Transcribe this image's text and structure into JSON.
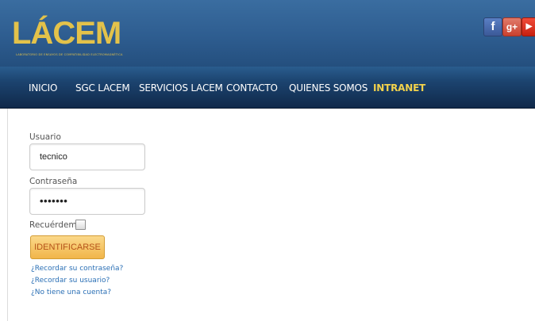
{
  "brand": {
    "logo_text": "LÁCEM",
    "logo_subtext": "LABORATORIO DE ENSAYOS DE COMPATIBILIDAD ELECTROMAGNÉTICA"
  },
  "social": {
    "facebook_glyph": "f",
    "googleplus_glyph": "g+",
    "youtube_glyph": "▶"
  },
  "nav": {
    "items": [
      {
        "label": "INICIO"
      },
      {
        "label": "SGC LACEM"
      },
      {
        "label": "SERVICIOS LACEM"
      },
      {
        "label": "CONTACTO"
      },
      {
        "label": "QUIENES SOMOS"
      },
      {
        "label": "INTRANET",
        "active": true
      }
    ]
  },
  "login": {
    "username_label": "Usuario",
    "username_value": "tecnico",
    "password_label": "Contraseña",
    "password_value": "•••••••",
    "remember_label": "Recuérdeme",
    "remember_checked": false,
    "submit_label": "IDENTIFICARSE",
    "links": [
      "¿Recordar su contraseña?",
      "¿Recordar su usuario?",
      "¿No tiene una cuenta?"
    ]
  },
  "colors": {
    "header_blue": "#2e5d90",
    "nav_dark": "#10294a",
    "accent_gold": "#e3c24a",
    "button_orange": "#f1b54a",
    "link_blue": "#2a6fb5"
  }
}
